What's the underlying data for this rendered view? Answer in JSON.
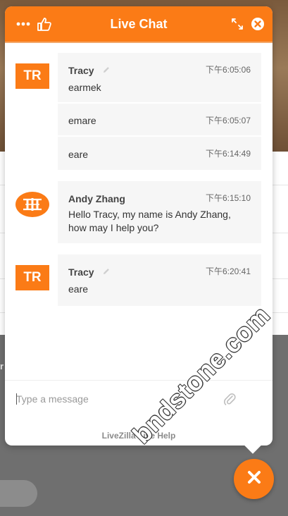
{
  "header": {
    "title": "Live Chat",
    "menu_icon": "more-dots-icon",
    "like_icon": "thumbs-up-icon",
    "expand_icon": "expand-arrows-icon",
    "close_icon": "close-circle-icon"
  },
  "messages": [
    {
      "avatar": "TR",
      "entries": [
        {
          "name": "Tracy",
          "time": "下午6:05:06",
          "text": "earmek"
        },
        {
          "name": "",
          "time": "下午6:05:07",
          "text": "emare"
        },
        {
          "name": "",
          "time": "下午6:14:49",
          "text": "eare"
        }
      ]
    },
    {
      "avatar_icon": "operator-logo-icon",
      "entries": [
        {
          "name": "Andy Zhang",
          "time": "下午6:15:10",
          "text_line1": "Hello Tracy, my name is Andy Zhang,",
          "text_line2": "how may I help you?"
        }
      ]
    },
    {
      "avatar": "TR",
      "entries": [
        {
          "name": "Tracy",
          "time": "下午6:20:41",
          "text": "eare"
        }
      ]
    }
  ],
  "composer": {
    "placeholder": "Type a message",
    "attach_icon": "paperclip-icon"
  },
  "footer": "LiveZilla Live Help",
  "fab_icon": "close-x-icon",
  "watermark": "bndstone.com",
  "colors": {
    "accent": "#fb7b16",
    "bubble": "#f6f6f6",
    "overlay": "#6f6f6f"
  }
}
